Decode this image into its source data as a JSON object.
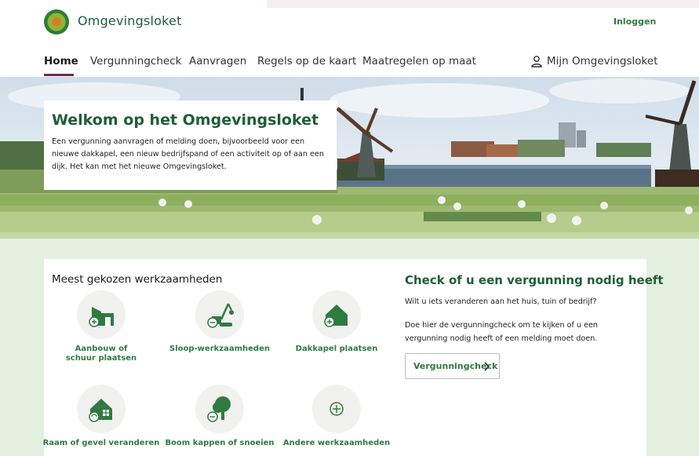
{
  "header": {
    "brand": "Omgevingsloket",
    "login": "Inloggen",
    "nav": [
      "Home",
      "Vergunningcheck",
      "Aanvragen",
      "Regels op de kaart",
      "Maatregelen op maat"
    ],
    "account": "Mijn Omgevingsloket"
  },
  "hero": {
    "title": "Welkom op het Omgevingsloket",
    "text": "Een vergunning aanvragen of melding doen, bijvoorbeeld voor een nieuwe dakkapel, een nieuw bedrijfspand of een activiteit op of aan een dijk. Het kan met het nieuwe Omgevingsloket."
  },
  "tasks": {
    "heading": "Meest gekozen werkzaamheden",
    "items": [
      {
        "label": "Aanbouw of schuur plaatsen",
        "icon": "extension-house-icon"
      },
      {
        "label": "Sloop-werkzaamheden",
        "icon": "demolition-crane-icon"
      },
      {
        "label": "Dakkapel plaatsen",
        "icon": "dormer-house-icon"
      },
      {
        "label": "Raam of gevel veranderen",
        "icon": "window-house-icon"
      },
      {
        "label": "Boom kappen of snoeien",
        "icon": "tree-icon"
      },
      {
        "label": "Andere werkzaamheden",
        "icon": "plus-circle-icon"
      }
    ]
  },
  "check": {
    "title": "Check of u een vergunning nodig heeft",
    "question": "Wilt u iets veranderen aan het huis, tuin of bedrijf?",
    "text": "Doe hier de vergunningcheck om te kijken of u een vergunning nodig heeft of een melding moet doen.",
    "button": "Vergunningcheck"
  },
  "colors": {
    "brand_green": "#1f5d3a",
    "link_green": "#2f7a40",
    "nav_underline": "#6b2f4e",
    "section_bg": "#e3efdf"
  }
}
